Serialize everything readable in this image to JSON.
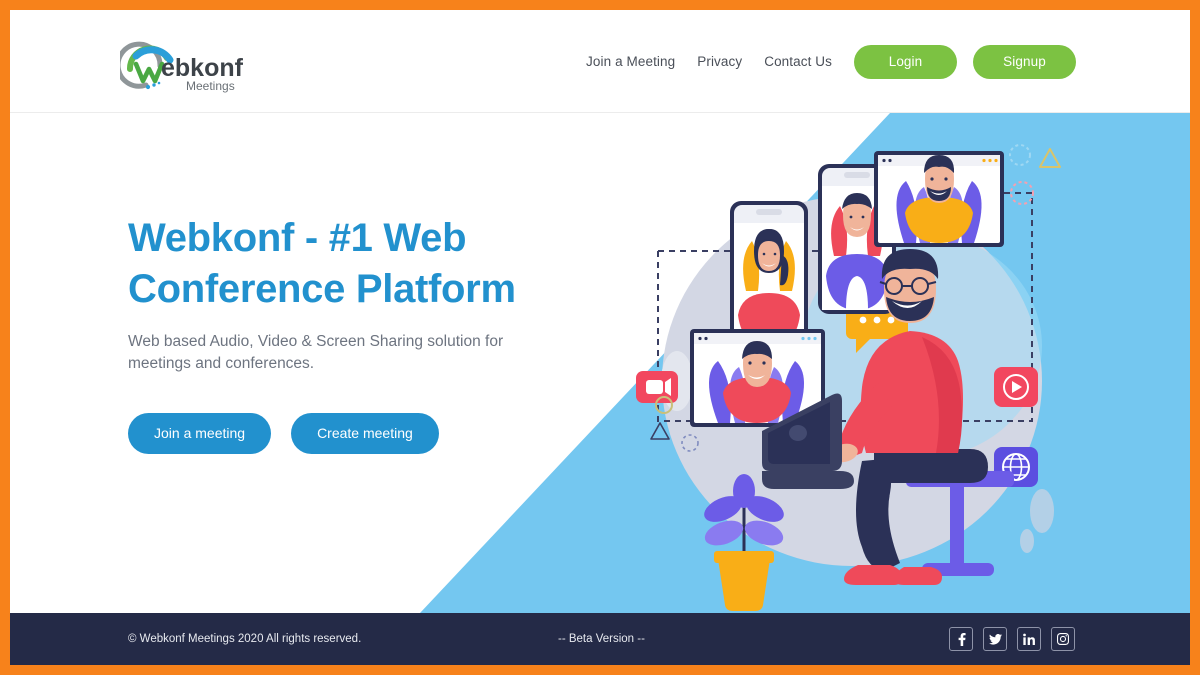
{
  "brand": {
    "logo_name": "Webkonf",
    "logo_sub": "Meetings",
    "logo_icon": "webkonf-swirl-logo",
    "accent_blue": "#2291ce",
    "accent_green": "#7cc242",
    "accent_orange": "#f7821b",
    "sky_blue": "#74c7f0",
    "footer_navy": "#242a47"
  },
  "nav": {
    "links": [
      {
        "label": "Join a Meeting"
      },
      {
        "label": "Privacy"
      },
      {
        "label": "Contact Us"
      }
    ],
    "login_label": "Login",
    "signup_label": "Signup"
  },
  "hero": {
    "headline_line1": "Webkonf - #1 Web",
    "headline_line2": "Conference Platform",
    "subhead": "Web based Audio, Video & Screen Sharing solution for meetings and conferences.",
    "cta_primary": "Join a meeting",
    "cta_secondary": "Create meeting",
    "illustration_name": "video-conference-illustration"
  },
  "footer": {
    "copyright": "© Webkonf Meetings 2020 All rights reserved.",
    "beta": "-- Beta Version --",
    "socials": [
      {
        "name": "facebook-icon"
      },
      {
        "name": "twitter-icon"
      },
      {
        "name": "linkedin-icon"
      },
      {
        "name": "instagram-icon"
      }
    ]
  }
}
